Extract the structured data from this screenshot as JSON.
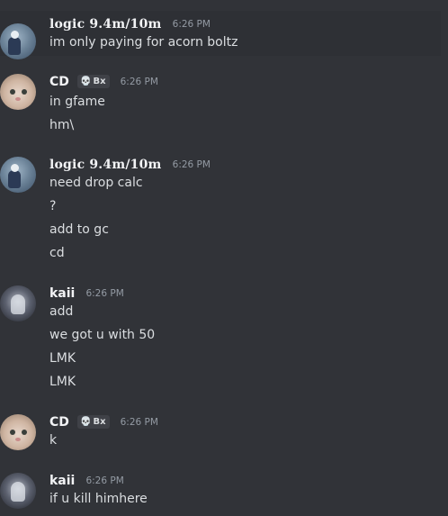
{
  "messages": [
    {
      "author": "logic 9.4m/10m",
      "time": "6:26 PM",
      "lines": [
        "im only paying for acorn boltz"
      ]
    },
    {
      "author": "CD",
      "tag": {
        "icon": "skull-icon",
        "glyph": "💀",
        "label": "Bx"
      },
      "time": "6:26 PM",
      "lines": [
        "in gfame",
        "hm\\"
      ]
    },
    {
      "author": "logic 9.4m/10m",
      "time": "6:26 PM",
      "lines": [
        "need drop calc",
        "?",
        "add to gc",
        "cd"
      ]
    },
    {
      "author": "kaii",
      "time": "6:26 PM",
      "lines": [
        "add",
        "we got u with 50",
        "LMK",
        "LMK"
      ]
    },
    {
      "author": "CD",
      "tag": {
        "icon": "skull-icon",
        "glyph": "💀",
        "label": "Bx"
      },
      "time": "6:26 PM",
      "lines": [
        "k"
      ]
    },
    {
      "author": "kaii",
      "time": "6:26 PM",
      "lines": [
        "if u kill himhere"
      ]
    }
  ],
  "colors": {
    "background": "#313338",
    "hover_background": "#2e3035",
    "text": "#dbdee1",
    "username": "#f2f3f5",
    "timestamp": "#949ba4"
  }
}
